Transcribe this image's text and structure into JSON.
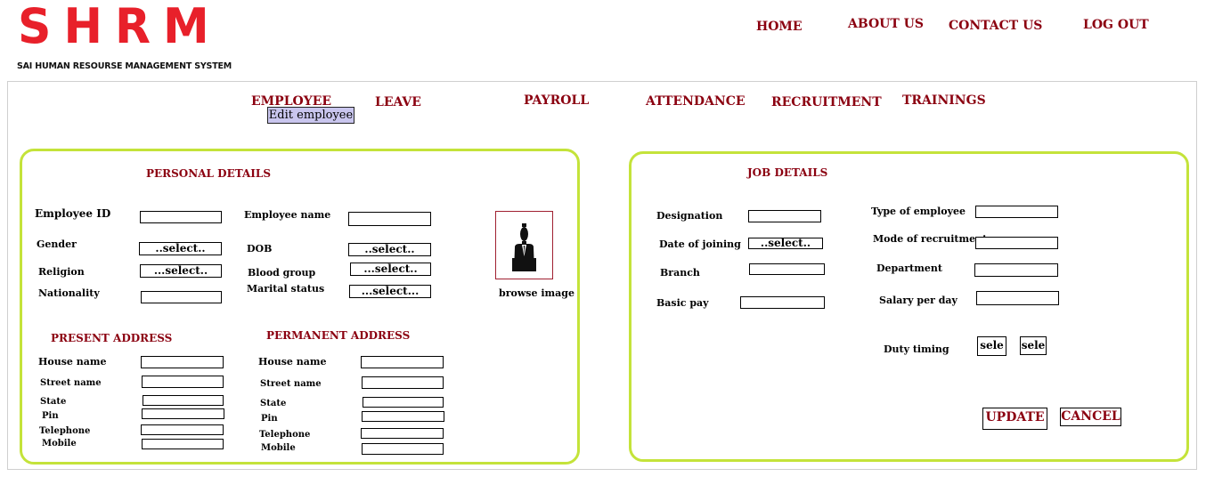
{
  "brand": {
    "logo": "SHRM",
    "tagline": "SAI HUMAN RESOURSE MANAGEMENT SYSTEM"
  },
  "topnav": {
    "home": "HOME",
    "about": "ABOUT US",
    "contact": "CONTACT US",
    "logout": "LOG OUT"
  },
  "modules": {
    "employee": "EMPLOYEE",
    "leave": "LEAVE",
    "payroll": "PAYROLL",
    "attendance": "ATTENDANCE",
    "recruitment": "RECRUITMENT",
    "trainings": "TRAININGS",
    "submenu": "Edit employee"
  },
  "personal": {
    "title": "PERSONAL DETAILS",
    "employee_id": "Employee ID",
    "employee_name": "Employee name",
    "gender": "Gender",
    "gender_select": "..select..",
    "dob": "DOB",
    "dob_select": "..select..",
    "religion": "Religion",
    "religion_select": "...select..",
    "blood_group": "Blood group",
    "blood_select": "...select..",
    "nationality": "Nationality",
    "marital_status": "Marital status",
    "marital_select": "...select...",
    "browse_image": "browse image"
  },
  "present_address": {
    "title": "PRESENT ADDRESS",
    "house_name": "House name",
    "street_name": "Street name",
    "state": "State",
    "pin": "Pin",
    "telephone": "Telephone",
    "mobile": "Mobile"
  },
  "permanent_address": {
    "title": "PERMANENT ADDRESS",
    "house_name": "House name",
    "street_name": "Street name",
    "state": "State",
    "pin": "Pin",
    "telephone": "Telephone",
    "mobile": "Mobile"
  },
  "job": {
    "title": "JOB DETAILS",
    "designation": "Designation",
    "date_of_joining": "Date of joining",
    "doj_select": "..select..",
    "branch": "Branch",
    "basic_pay": "Basic pay",
    "type_of_employee": "Type of employee",
    "mode_of_recruitment": "Mode of recruitment",
    "department": "Department",
    "salary_per_day": "Salary per day",
    "duty_timing": "Duty timing",
    "duty_from": "sele",
    "duty_to": "sele"
  },
  "actions": {
    "update": "UPDATE",
    "cancel": "CANCEL"
  },
  "colors": {
    "brand_red": "#e8202a",
    "nav_maroon": "#8b0010",
    "panel_border": "#c4e33a",
    "submenu_bg": "#c9c6ee"
  },
  "icons": {
    "photo_placeholder": "person-silhouette-icon"
  }
}
